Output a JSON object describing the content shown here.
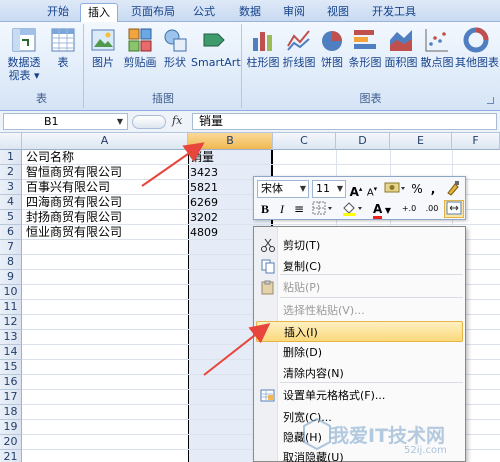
{
  "ribbon": {
    "tabs": [
      "开始",
      "插入",
      "页面布局",
      "公式",
      "数据",
      "审阅",
      "视图",
      "开发工具"
    ],
    "active_tab": "插入",
    "groups": [
      {
        "label": "表",
        "buttons": [
          "数据透视表 ▾",
          "表"
        ]
      },
      {
        "label": "插图",
        "buttons": [
          "图片",
          "剪贴画",
          "形状",
          "SmartArt"
        ]
      },
      {
        "label": "图表",
        "buttons": [
          "柱形图",
          "折线图",
          "饼图",
          "条形图",
          "面积图",
          "散点图",
          "其他图表"
        ]
      }
    ]
  },
  "formula_bar": {
    "name_box": "B1",
    "fx": "fx",
    "content": "销量"
  },
  "grid": {
    "columns": [
      "A",
      "B",
      "C",
      "D",
      "E",
      "F"
    ],
    "selected_column": "B",
    "rows": [
      "1",
      "2",
      "3",
      "4",
      "5",
      "6",
      "7",
      "8",
      "9",
      "10",
      "11",
      "12",
      "13",
      "14",
      "15",
      "16",
      "17",
      "18",
      "19",
      "20",
      "21"
    ],
    "cells": [
      {
        "a": "公司名称",
        "b": "销量"
      },
      {
        "a": "智恒商贸有限公司",
        "b": "3423"
      },
      {
        "a": "百事兴有限公司",
        "b": "5821"
      },
      {
        "a": "四海商贸有限公司",
        "b": "6269"
      },
      {
        "a": "封扬商贸有限公司",
        "b": "3202"
      },
      {
        "a": "恒业商贸有限公司",
        "b": "4809"
      }
    ]
  },
  "mini_toolbar": {
    "font": "宋体",
    "size": "11",
    "grow": "A",
    "shrink": "A",
    "percent": "%",
    "comma": ",",
    "bold": "B",
    "italic": "I",
    "align": "≡",
    "font_color_letter": "A",
    "inc_decimal": "+.0",
    "dec_decimal": ".00"
  },
  "context_menu": {
    "items": [
      {
        "label": "剪切(T)",
        "icon": "scissors-icon",
        "disabled": false
      },
      {
        "label": "复制(C)",
        "icon": "copy-icon",
        "disabled": false
      },
      {
        "label": "粘贴(P)",
        "icon": "paste-icon",
        "disabled": true
      },
      {
        "label": "选择性粘贴(V)...",
        "icon": "",
        "disabled": true
      },
      {
        "label": "插入(I)",
        "icon": "",
        "disabled": false,
        "hover": true
      },
      {
        "label": "删除(D)",
        "icon": "",
        "disabled": false
      },
      {
        "label": "清除内容(N)",
        "icon": "",
        "disabled": false
      },
      {
        "label": "设置单元格格式(F)...",
        "icon": "format-cells-icon",
        "disabled": false
      },
      {
        "label": "列宽(C)...",
        "icon": "",
        "disabled": false
      },
      {
        "label": "隐藏(H)",
        "icon": "",
        "disabled": false
      },
      {
        "label": "取消隐藏(U)",
        "icon": "",
        "disabled": false
      }
    ]
  },
  "watermark": {
    "text": "我爱IT技术网",
    "sub": "52ij.com"
  },
  "colors": {
    "accent": "#e8453c",
    "ribbon_text": "#15428b",
    "selection": "#f1b852"
  }
}
